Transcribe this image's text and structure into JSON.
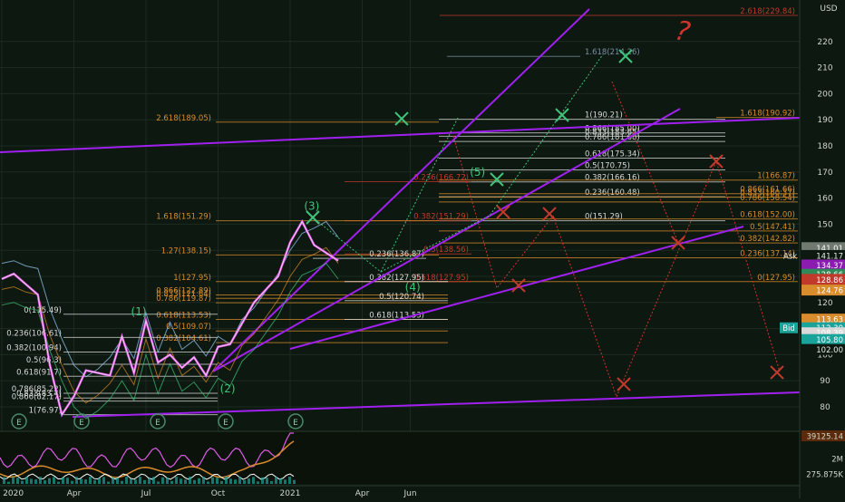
{
  "chart_data": {
    "type": "line",
    "currency": "USD",
    "y_axis_ticks": [
      80,
      90,
      100,
      110,
      120,
      130,
      140,
      150,
      160,
      170,
      180,
      190,
      200,
      210,
      220
    ],
    "x_axis_ticks": [
      "2020",
      "Apr",
      "Jul",
      "Oct",
      "2021",
      "Apr",
      "Jun"
    ],
    "ylim": [
      75,
      231
    ],
    "price_tags": [
      {
        "label": "141.01",
        "value": 141.01,
        "color": "#707a70"
      },
      {
        "label": "Ask",
        "value": 138.0,
        "color": "#0d1810"
      },
      {
        "label": "141.17",
        "value": 138.0,
        "color": "#0d1810"
      },
      {
        "label": "134.37",
        "value": 134.37,
        "color": "#8a1cb0"
      },
      {
        "label": "128.66",
        "value": 130.8,
        "color": "#2e8b57"
      },
      {
        "label": "128.86",
        "value": 128.86,
        "color": "#c0392b"
      },
      {
        "label": "124.76",
        "value": 124.76,
        "color": "#d98c2b"
      },
      {
        "label": "113.63",
        "value": 113.63,
        "color": "#d98c2b"
      },
      {
        "label": "112.30",
        "value": 110.3,
        "color": "#1aa39b"
      },
      {
        "label": "108.39",
        "value": 108.39,
        "color": "#d9d9d9"
      },
      {
        "label": "105.80",
        "value": 105.8,
        "color": "#1aa39b"
      },
      {
        "label": "102.00",
        "value": 102.0,
        "color": "#0d1810"
      }
    ],
    "bid_label": "Bid",
    "price_series": {
      "months": [
        0,
        0.5,
        1,
        1.5,
        2,
        2.5,
        3,
        3.5,
        4,
        4.5,
        5,
        5.5,
        6,
        6.5,
        7,
        7.5,
        8,
        8.5,
        9,
        9.5,
        10,
        10.5,
        11,
        11.5,
        12,
        12.5,
        13,
        13.5,
        14
      ],
      "values": [
        129,
        131,
        127,
        123,
        96,
        77,
        84,
        94,
        93,
        92,
        107,
        93,
        113,
        97,
        100,
        95,
        99,
        92,
        103,
        104,
        112,
        120,
        125,
        130,
        143,
        151,
        142,
        139,
        136
      ]
    },
    "fib_levels": [
      {
        "label": "2.618(229.84)",
        "value": 230,
        "color": "#c0392b"
      },
      {
        "label": "1.618(214.26)",
        "value": 214.3,
        "color": "#7a8fa6"
      },
      {
        "label": "2.618(189.05)",
        "value": 189.1,
        "color": "#d98c2b"
      },
      {
        "label": "1(190.21)",
        "value": 190.2,
        "color": "#d9d9d9"
      },
      {
        "label": "1.618(190.92)",
        "value": 190.9,
        "color": "#d98c2b"
      },
      {
        "label": "0.866(185.00)",
        "value": 185,
        "color": "#d9d9d9"
      },
      {
        "label": "0.833(183.65)",
        "value": 183.7,
        "color": "#d9d9d9"
      },
      {
        "label": "0.786(181.68)",
        "value": 181.7,
        "color": "#d9d9d9"
      },
      {
        "label": "0.618(175.34)",
        "value": 175.3,
        "color": "#d9d9d9"
      },
      {
        "label": "0.5(170.75)",
        "value": 170.8,
        "color": "#d9d9d9"
      },
      {
        "label": "0.382(166.16)",
        "value": 166.2,
        "color": "#d9d9d9"
      },
      {
        "label": "0.236(160.48)",
        "value": 160.5,
        "color": "#d9d9d9"
      },
      {
        "label": "0(151.29)",
        "value": 151.3,
        "color": "#d9d9d9"
      },
      {
        "label": "1(166.87)",
        "value": 166.9,
        "color": "#d98c2b"
      },
      {
        "label": "0.866(161.66)",
        "value": 161.7,
        "color": "#d98c2b"
      },
      {
        "label": "0.833(160.37)",
        "value": 160.4,
        "color": "#d98c2b"
      },
      {
        "label": "0.786(158.54)",
        "value": 158.5,
        "color": "#d98c2b"
      },
      {
        "label": "0.618(152.00)",
        "value": 152,
        "color": "#d98c2b"
      },
      {
        "label": "0.5(147.41)",
        "value": 147.4,
        "color": "#d98c2b"
      },
      {
        "label": "0.382(142.82)",
        "value": 142.8,
        "color": "#d98c2b"
      },
      {
        "label": "0.236(137.14)",
        "value": 137.1,
        "color": "#d98c2b"
      },
      {
        "label": "0(127.95)",
        "value": 128,
        "color": "#d98c2b"
      },
      {
        "label": "0.236(166.72)",
        "value": 166.3,
        "color": "#c0392b"
      },
      {
        "label": "0.382(151.29)",
        "value": 151.3,
        "color": "#c0392b"
      },
      {
        "label": "0.5(138.56)",
        "value": 138.6,
        "color": "#c0392b"
      },
      {
        "label": "0.618(127.95)",
        "value": 128,
        "color": "#c0392b"
      },
      {
        "label": "1.618(151.29)",
        "value": 151.3,
        "color": "#d98c2b"
      },
      {
        "label": "1.27(138.15)",
        "value": 138.2,
        "color": "#d98c2b"
      },
      {
        "label": "1(127.95)",
        "value": 128,
        "color": "#d98c2b"
      },
      {
        "label": "0.866(122.89)",
        "value": 122.9,
        "color": "#d98c2b"
      },
      {
        "label": "0.833(121.64)",
        "value": 121.6,
        "color": "#d98c2b"
      },
      {
        "label": "0.786(119.87)",
        "value": 119.9,
        "color": "#d98c2b"
      },
      {
        "label": "0.618(113.53)",
        "value": 113.5,
        "color": "#d98c2b"
      },
      {
        "label": "0.5(109.07)",
        "value": 109.1,
        "color": "#d98c2b"
      },
      {
        "label": "0.382(104.61)",
        "value": 104.6,
        "color": "#d98c2b"
      },
      {
        "label": "0.236(136.87)",
        "value": 136.9,
        "color": "#d9d9d9"
      },
      {
        "label": "0.382(127.95)",
        "value": 128,
        "color": "#d9d9d9"
      },
      {
        "label": "0.5(120.74)",
        "value": 120.7,
        "color": "#d9d9d9"
      },
      {
        "label": "0.618(113.53)",
        "value": 113.5,
        "color": "#d9d9d9"
      },
      {
        "label": "0(115.49)",
        "value": 115.5,
        "color": "#d9d9d9"
      },
      {
        "label": "0.236(106.61)",
        "value": 106.6,
        "color": "#d9d9d9"
      },
      {
        "label": "0.382(100.94)",
        "value": 101,
        "color": "#d9d9d9"
      },
      {
        "label": "0.5(96.3)",
        "value": 96.3,
        "color": "#d9d9d9"
      },
      {
        "label": "0.618(91.7)",
        "value": 91.7,
        "color": "#d9d9d9"
      },
      {
        "label": "0.786(85.22)",
        "value": 85.2,
        "color": "#d9d9d9"
      },
      {
        "label": "0.833(83.4)",
        "value": 83.4,
        "color": "#d9d9d9"
      },
      {
        "label": "0.866(82.17)",
        "value": 82.2,
        "color": "#d9d9d9"
      },
      {
        "label": "1(76.97)",
        "value": 77,
        "color": "#d9d9d9"
      }
    ],
    "wave_labels": [
      {
        "text": "(1)",
        "month": 5.7,
        "value": 115,
        "color": "#3ec47a"
      },
      {
        "text": "(2)",
        "month": 9.4,
        "value": 85.5,
        "color": "#3ec47a"
      },
      {
        "text": "(3)",
        "month": 12.9,
        "value": 155.5,
        "color": "#3ec47a"
      },
      {
        "text": "(4)",
        "month": 17.1,
        "value": 124.5,
        "color": "#3ec47a"
      },
      {
        "text": "(5)",
        "month": 19.8,
        "value": 168.5,
        "color": "#3ec47a"
      }
    ],
    "annotation_text": "?",
    "earnings_markers": [
      "E",
      "E",
      "E",
      "E",
      "E",
      "E"
    ],
    "volume_axis_labels": [
      "39125.14",
      "2M",
      "275.875K"
    ]
  }
}
